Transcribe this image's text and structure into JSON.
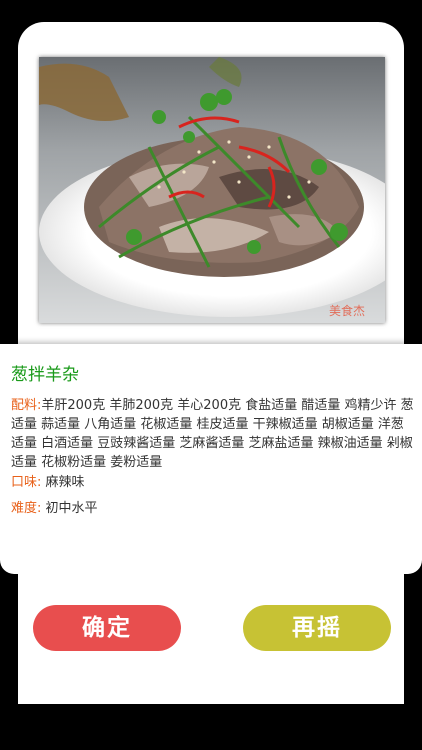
{
  "dish": {
    "name": "葱拌羊杂",
    "ingredients_label": "配料:",
    "ingredients": "羊肝200克  羊肺200克  羊心200克  食盐适量  醋适量  鸡精少许  葱适量  蒜适量  八角适量  花椒适量  桂皮适量  干辣椒适量  胡椒适量  洋葱适量  白酒适量  豆豉辣酱适量  芝麻酱适量  芝麻盐适量  辣椒油适量  剁椒适量  花椒粉适量  姜粉适量",
    "taste_label": "口味:",
    "taste": "麻辣味",
    "difficulty_label": "难度:",
    "difficulty": "初中水平"
  },
  "buttons": {
    "confirm_label": "确定",
    "reshake_label": "再摇"
  },
  "photo": {
    "watermark": "美食杰"
  },
  "colors": {
    "title_green": "#1a9a1a",
    "key_orange": "#e8611a",
    "confirm_red": "#e84e4e",
    "reshake_yellow": "#c7c234"
  }
}
